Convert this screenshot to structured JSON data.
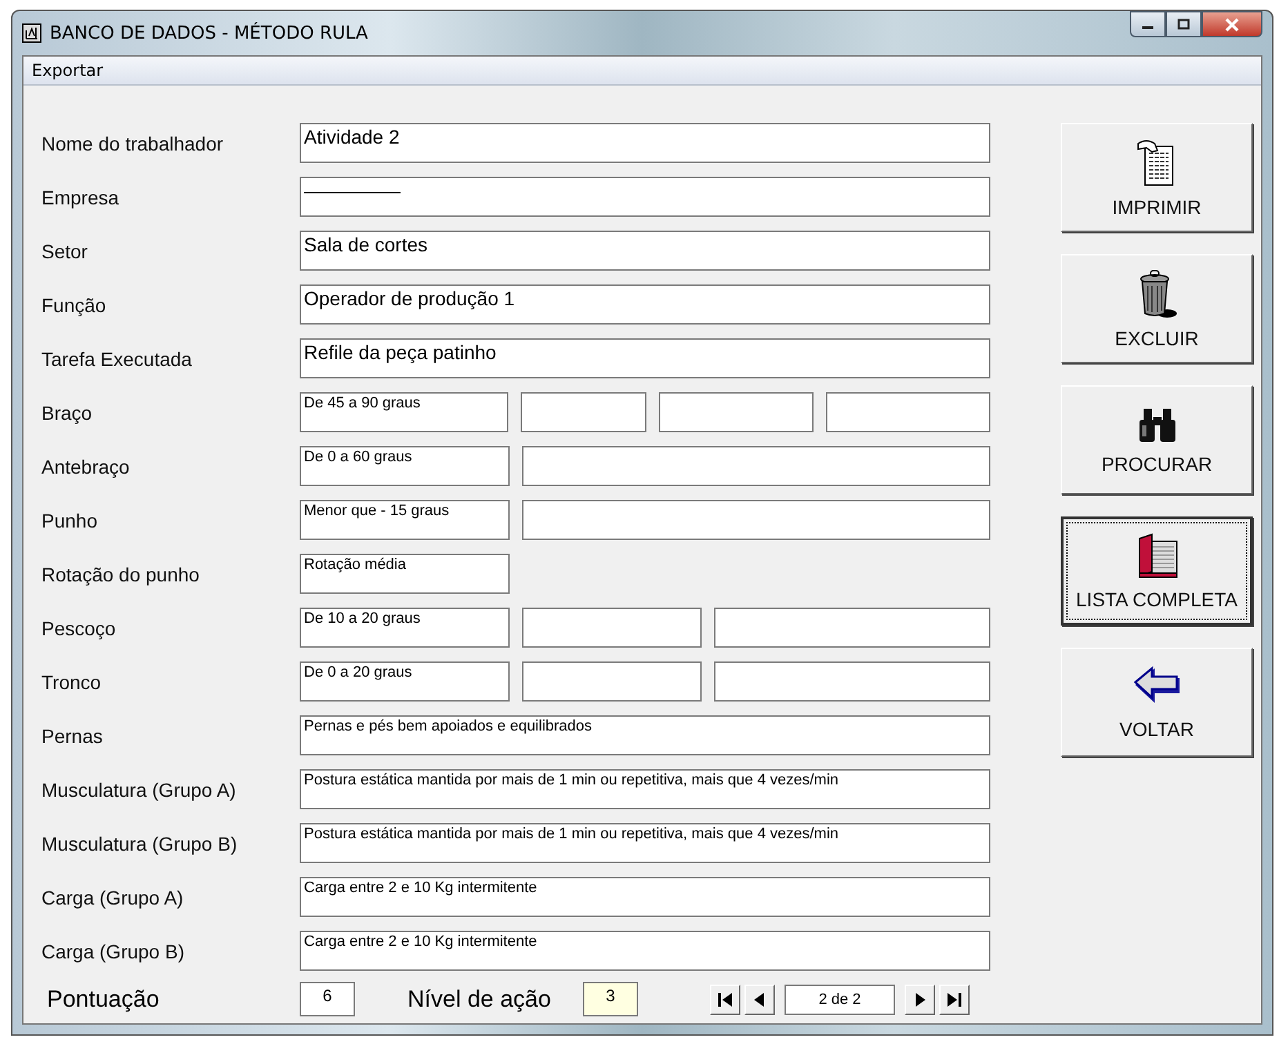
{
  "window": {
    "title": "BANCO DE DADOS - MÉTODO RULA"
  },
  "menu": [
    {
      "label": "Exportar"
    }
  ],
  "fields": [
    {
      "label": "Nome do trabalhador",
      "kind": "text",
      "value": "Atividade 2"
    },
    {
      "label": "Empresa",
      "kind": "text",
      "value": "—————"
    },
    {
      "label": "Setor",
      "kind": "text",
      "value": "Sala de cortes"
    },
    {
      "label": "Função",
      "kind": "text",
      "value": "Operador de produção 1"
    },
    {
      "label": "Tarefa Executada",
      "kind": "text",
      "value": "Refile da peça patinho"
    },
    {
      "label": "Braço",
      "kind": "short4",
      "value": "De 45 a 90 graus"
    },
    {
      "label": "Antebraço",
      "kind": "short2",
      "value": "De 0 a 60 graus"
    },
    {
      "label": "Punho",
      "kind": "short2",
      "value": "Menor que - 15 graus"
    },
    {
      "label": "Rotação do punho",
      "kind": "short",
      "value": "Rotação média"
    },
    {
      "label": "Pescoço",
      "kind": "short3",
      "value": "De 10 a 20 graus"
    },
    {
      "label": "Tronco",
      "kind": "short3",
      "value": "De 0 a 20 graus"
    },
    {
      "label": "Pernas",
      "kind": "long",
      "value": "Pernas e pés bem apoiados e equilibrados"
    },
    {
      "label": "Musculatura (Grupo A)",
      "kind": "long",
      "value": "Postura estática mantida por mais de 1 min ou repetitiva, mais que 4 vezes/min"
    },
    {
      "label": "Musculatura (Grupo B)",
      "kind": "long",
      "value": "Postura estática mantida por mais de 1 min ou repetitiva, mais que 4 vezes/min"
    },
    {
      "label": "Carga (Grupo A)",
      "kind": "long",
      "value": "Carga entre 2 e 10 Kg intermitente"
    },
    {
      "label": "Carga (Grupo B)",
      "kind": "long",
      "value": "Carga entre 2 e 10 Kg intermitente"
    }
  ],
  "score": {
    "label": "Pontuação",
    "value": "6"
  },
  "action_level": {
    "label": "Nível de ação",
    "value": "3"
  },
  "navigator": {
    "position": "2 de 2"
  },
  "buttons": [
    {
      "label": "IMPRIMIR",
      "kind": "print",
      "focused": false
    },
    {
      "label": "EXCLUIR",
      "kind": "delete",
      "focused": false
    },
    {
      "label": "PROCURAR",
      "kind": "search",
      "focused": false
    },
    {
      "label": "LISTA COMPLETA",
      "kind": "list",
      "focused": true
    },
    {
      "label": "VOLTAR",
      "kind": "back",
      "focused": false
    }
  ]
}
